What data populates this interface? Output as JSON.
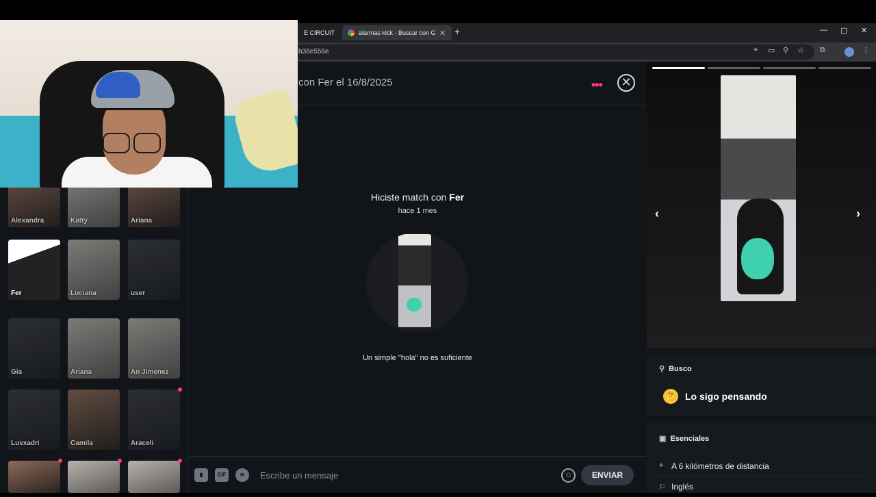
{
  "browser": {
    "tabs": [
      {
        "title": "E CIRCUIT",
        "close": "✕"
      },
      {
        "title": "alarmas kick - Buscar con Goog",
        "close": "✕"
      }
    ],
    "new_tab": "+",
    "url": "b36e556e",
    "window_controls": {
      "minimize": "—",
      "maximize": "▢",
      "close": "✕"
    }
  },
  "sidebar": {
    "matches": [
      {
        "name": "Alexandra"
      },
      {
        "name": "Katty"
      },
      {
        "name": "Ariana"
      },
      {
        "name": "Fer"
      },
      {
        "name": "Luciana"
      },
      {
        "name": "user"
      },
      {
        "name": "Gia"
      },
      {
        "name": "Ariana"
      },
      {
        "name": "An Jimenez"
      },
      {
        "name": "Luvxadri"
      },
      {
        "name": "Camila"
      },
      {
        "name": "Araceli"
      }
    ]
  },
  "chat": {
    "title": "con Fer el 16/8/2025",
    "more": "•••",
    "close": "✕",
    "match_prefix": "Hiciste match con ",
    "match_name": "Fer",
    "match_time": "hace 1 mes",
    "tip": "Un simple \"hola\" no es suficiente",
    "composer": {
      "gif": "GIF",
      "placeholder": "Escribe un mensaje",
      "send": "ENVIAR"
    }
  },
  "profile": {
    "busco_label": "Busco",
    "busco_value": "Lo sigo pensando",
    "esenciales_label": "Esenciales",
    "rows": [
      {
        "icon": "location-icon",
        "text": "A 6 kilómetros de distancia"
      },
      {
        "icon": "language-icon",
        "text": "Inglés"
      }
    ]
  },
  "colors": {
    "accent": "#fe3c72",
    "background": "#111418",
    "plush": "#3fd0b0"
  }
}
